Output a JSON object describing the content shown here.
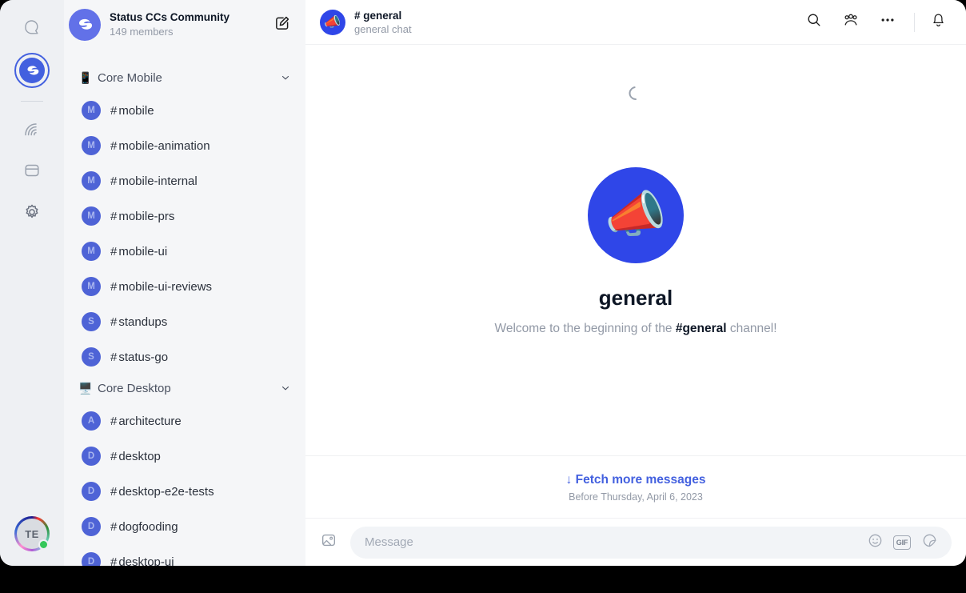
{
  "nav_rail": {
    "items": [
      {
        "name": "messages",
        "icon": "chat-bubble-icon"
      },
      {
        "name": "status-community",
        "icon": "status-logo-icon",
        "active": true
      },
      {
        "name": "communities",
        "icon": "communities-icon"
      },
      {
        "name": "wallet",
        "icon": "wallet-icon"
      },
      {
        "name": "settings",
        "icon": "gear-icon"
      }
    ],
    "profile": {
      "initials": "TE",
      "status": "online"
    }
  },
  "sidebar": {
    "community": {
      "name": "Status CCs Community",
      "members": "149 members",
      "avatar_icon": "status-logo-icon"
    },
    "compose_icon": "compose-edit-icon",
    "categories": [
      {
        "emoji": "📱",
        "name": "Core Mobile",
        "expanded": true,
        "channels": [
          {
            "initial": "M",
            "hash": "#",
            "name": "mobile"
          },
          {
            "initial": "M",
            "hash": "#",
            "name": "mobile-animation"
          },
          {
            "initial": "M",
            "hash": "#",
            "name": "mobile-internal"
          },
          {
            "initial": "M",
            "hash": "#",
            "name": "mobile-prs"
          },
          {
            "initial": "M",
            "hash": "#",
            "name": "mobile-ui"
          },
          {
            "initial": "M",
            "hash": "#",
            "name": "mobile-ui-reviews"
          },
          {
            "initial": "S",
            "hash": "#",
            "name": "standups"
          },
          {
            "initial": "S",
            "hash": "#",
            "name": "status-go"
          }
        ]
      },
      {
        "emoji": "🖥️",
        "name": "Core Desktop",
        "expanded": true,
        "channels": [
          {
            "initial": "A",
            "hash": "#",
            "name": "architecture"
          },
          {
            "initial": "D",
            "hash": "#",
            "name": "desktop"
          },
          {
            "initial": "D",
            "hash": "#",
            "name": "desktop-e2e-tests"
          },
          {
            "initial": "D",
            "hash": "#",
            "name": "dogfooding"
          },
          {
            "initial": "D",
            "hash": "#",
            "name": "desktop-ui"
          }
        ]
      }
    ]
  },
  "chat": {
    "header": {
      "avatar_emoji": "📣",
      "title": "# general",
      "subtitle": "general chat",
      "icons": [
        "search-icon",
        "members-icon",
        "more-options-icon",
        "notifications-bell-icon"
      ]
    },
    "loading": true,
    "intro": {
      "avatar_emoji": "📣",
      "name": "general",
      "welcome_prefix": "Welcome to the beginning of the ",
      "welcome_channel": "#general",
      "welcome_suffix": " channel!"
    },
    "fetch": {
      "arrow": "↓",
      "label": "Fetch more messages",
      "date": "Before Thursday, April 6, 2023"
    },
    "composer": {
      "attach_icon": "image-attach-icon",
      "placeholder": "Message",
      "value": "",
      "emoji_icon": "emoji-smiley-icon",
      "gif_label": "GIF",
      "sticker_icon": "sticker-icon"
    }
  },
  "colors": {
    "accent": "#4360df",
    "channel_avatar": "#4e63d6",
    "community_avatar": "#6271e8",
    "chat_avatar": "#2f46e8",
    "sidebar_bg": "#f5f6f8",
    "rail_bg": "#eef0f3",
    "online": "#34c759",
    "muted_text": "#9299a6"
  }
}
